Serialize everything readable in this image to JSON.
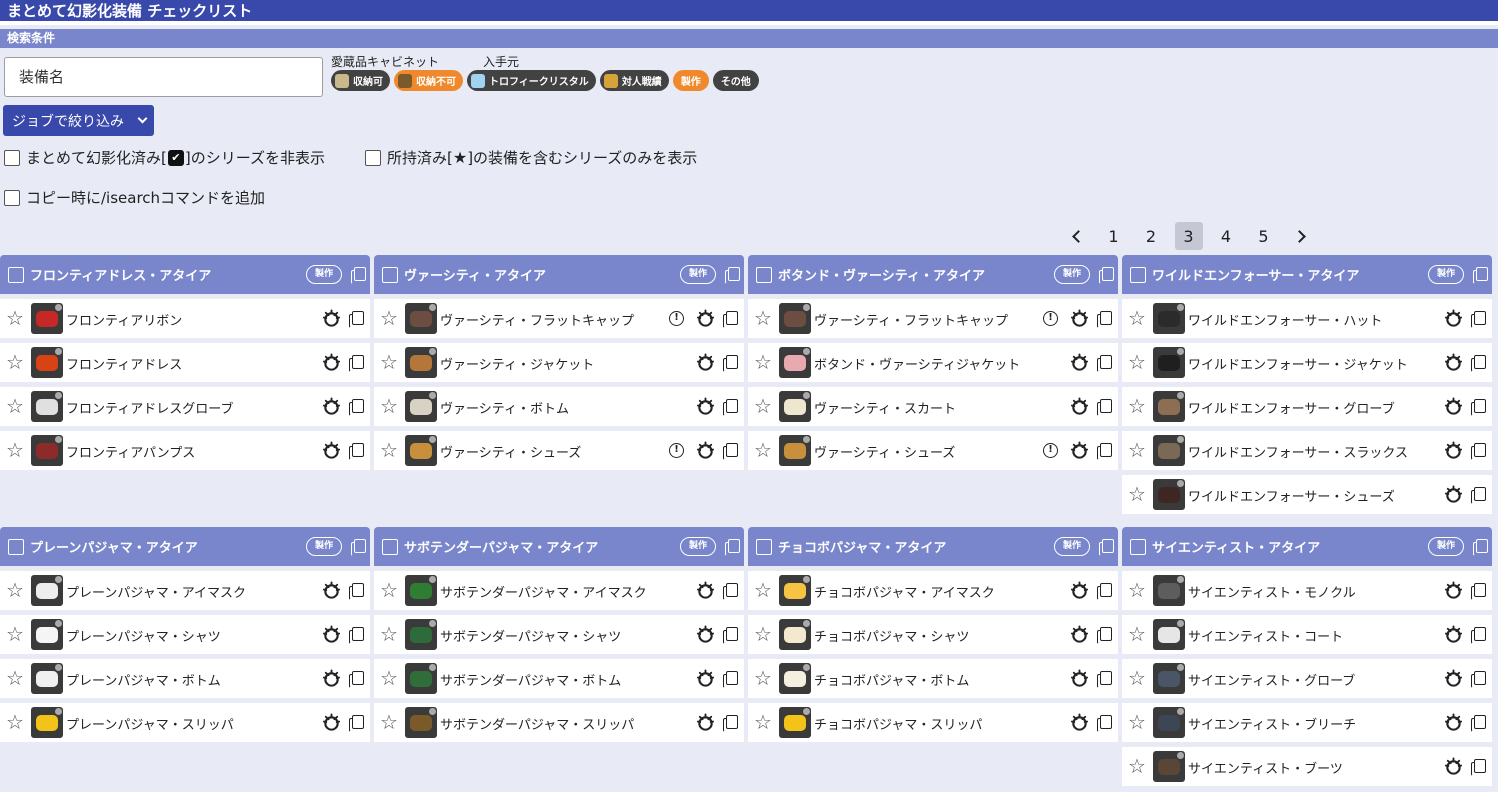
{
  "app": {
    "title": "まとめて幻影化装備 チェックリスト",
    "search_section": "検索条件"
  },
  "filters": {
    "name_placeholder": "装備名",
    "cabinet_label": "愛蔵品キャビネット",
    "source_label": "入手元",
    "chips": [
      {
        "label": "収納可",
        "style": "dark",
        "icon": "cabinet-icon",
        "icon_color": "#c9b98a"
      },
      {
        "label": "収納不可",
        "style": "orange",
        "icon": "cabinet-icon",
        "icon_color": "#7a5a2a"
      },
      {
        "label": "トロフィークリスタル",
        "style": "dark",
        "icon": "crystal-icon",
        "icon_color": "#9fd3f0"
      },
      {
        "label": "対人戦績",
        "style": "dark",
        "icon": "pvp-icon",
        "icon_color": "#d6a23a"
      },
      {
        "label": "製作",
        "style": "orange",
        "icon": "",
        "icon_color": ""
      },
      {
        "label": "その他",
        "style": "dark",
        "icon": "",
        "icon_color": ""
      }
    ],
    "job_button": "ジョブで絞り込み",
    "options": {
      "hide_done_pre": "まとめて幻影化済み[",
      "hide_done_post": "]のシリーズを非表示",
      "owned_only_pre": "所持済み[",
      "owned_only_post": "]の装備を含むシリーズのみを表示",
      "add_isearch": "コピー時に/isearchコマンドを追加",
      "check_glyph": "✔",
      "star_glyph": "★"
    }
  },
  "pagination": {
    "pages": [
      "1",
      "2",
      "3",
      "4",
      "5"
    ],
    "current": "3"
  },
  "series": [
    {
      "name": "フロンティアドレス・アタイア",
      "badge": "製作",
      "items": [
        {
          "name": "フロンティアリボン",
          "color": "#c62828",
          "warn": false
        },
        {
          "name": "フロンティアドレス",
          "color": "#d84315",
          "warn": false
        },
        {
          "name": "フロンティアドレスグローブ",
          "color": "#e0e0e0",
          "warn": false
        },
        {
          "name": "フロンティアパンプス",
          "color": "#8d2a2a",
          "warn": false
        }
      ]
    },
    {
      "name": "ヴァーシティ・アタイア",
      "badge": "製作",
      "items": [
        {
          "name": "ヴァーシティ・フラットキャップ",
          "color": "#6d4c41",
          "warn": true
        },
        {
          "name": "ヴァーシティ・ジャケット",
          "color": "#b5763a",
          "warn": false
        },
        {
          "name": "ヴァーシティ・ボトム",
          "color": "#d7d2c4",
          "warn": false
        },
        {
          "name": "ヴァーシティ・シューズ",
          "color": "#c88f3c",
          "warn": true
        }
      ]
    },
    {
      "name": "ボタンド・ヴァーシティ・アタイア",
      "badge": "製作",
      "items": [
        {
          "name": "ヴァーシティ・フラットキャップ",
          "color": "#6d4c41",
          "warn": true
        },
        {
          "name": "ボタンド・ヴァーシティジャケット",
          "color": "#e8a9b0",
          "warn": false
        },
        {
          "name": "ヴァーシティ・スカート",
          "color": "#efe6cf",
          "warn": false
        },
        {
          "name": "ヴァーシティ・シューズ",
          "color": "#c88f3c",
          "warn": true
        }
      ]
    },
    {
      "name": "ワイルドエンフォーサー・アタイア",
      "badge": "製作",
      "items": [
        {
          "name": "ワイルドエンフォーサー・ハット",
          "color": "#2b2b2b",
          "warn": false
        },
        {
          "name": "ワイルドエンフォーサー・ジャケット",
          "color": "#1f1f1f",
          "warn": false
        },
        {
          "name": "ワイルドエンフォーサー・グローブ",
          "color": "#8d6e53",
          "warn": false
        },
        {
          "name": "ワイルドエンフォーサー・スラックス",
          "color": "#7a6a55",
          "warn": false
        },
        {
          "name": "ワイルドエンフォーサー・シューズ",
          "color": "#3e2723",
          "warn": false
        }
      ]
    },
    {
      "name": "プレーンパジャマ・アタイア",
      "badge": "製作",
      "items": [
        {
          "name": "プレーンパジャマ・アイマスク",
          "color": "#eeeeee",
          "warn": false
        },
        {
          "name": "プレーンパジャマ・シャツ",
          "color": "#f5f5f5",
          "warn": false
        },
        {
          "name": "プレーンパジャマ・ボトム",
          "color": "#f0f0f0",
          "warn": false
        },
        {
          "name": "プレーンパジャマ・スリッパ",
          "color": "#f2c318",
          "warn": false
        }
      ]
    },
    {
      "name": "サボテンダーパジャマ・アタイア",
      "badge": "製作",
      "items": [
        {
          "name": "サボテンダーパジャマ・アイマスク",
          "color": "#2e7d32",
          "warn": false
        },
        {
          "name": "サボテンダーパジャマ・シャツ",
          "color": "#2e6b3a",
          "warn": false
        },
        {
          "name": "サボテンダーパジャマ・ボトム",
          "color": "#2f6e3a",
          "warn": false
        },
        {
          "name": "サボテンダーパジャマ・スリッパ",
          "color": "#7b5a2a",
          "warn": false
        }
      ]
    },
    {
      "name": "チョコボパジャマ・アタイア",
      "badge": "製作",
      "items": [
        {
          "name": "チョコボパジャマ・アイマスク",
          "color": "#f6c343",
          "warn": false
        },
        {
          "name": "チョコボパジャマ・シャツ",
          "color": "#f3e9cf",
          "warn": false
        },
        {
          "name": "チョコボパジャマ・ボトム",
          "color": "#f5efe0",
          "warn": false
        },
        {
          "name": "チョコボパジャマ・スリッパ",
          "color": "#f2c318",
          "warn": false
        }
      ]
    },
    {
      "name": "サイエンティスト・アタイア",
      "badge": "製作",
      "items": [
        {
          "name": "サイエンティスト・モノクル",
          "color": "#5d5d5d",
          "warn": false
        },
        {
          "name": "サイエンティスト・コート",
          "color": "#e6e6e6",
          "warn": false
        },
        {
          "name": "サイエンティスト・グローブ",
          "color": "#4a5568",
          "warn": false
        },
        {
          "name": "サイエンティスト・ブリーチ",
          "color": "#3d4654",
          "warn": false
        },
        {
          "name": "サイエンティスト・ブーツ",
          "color": "#5a4636",
          "warn": false
        }
      ]
    }
  ],
  "theme": {
    "primary": "#3949ab",
    "header": "#7986cb",
    "background": "#e8eaf6",
    "accent": "#f0882c"
  }
}
